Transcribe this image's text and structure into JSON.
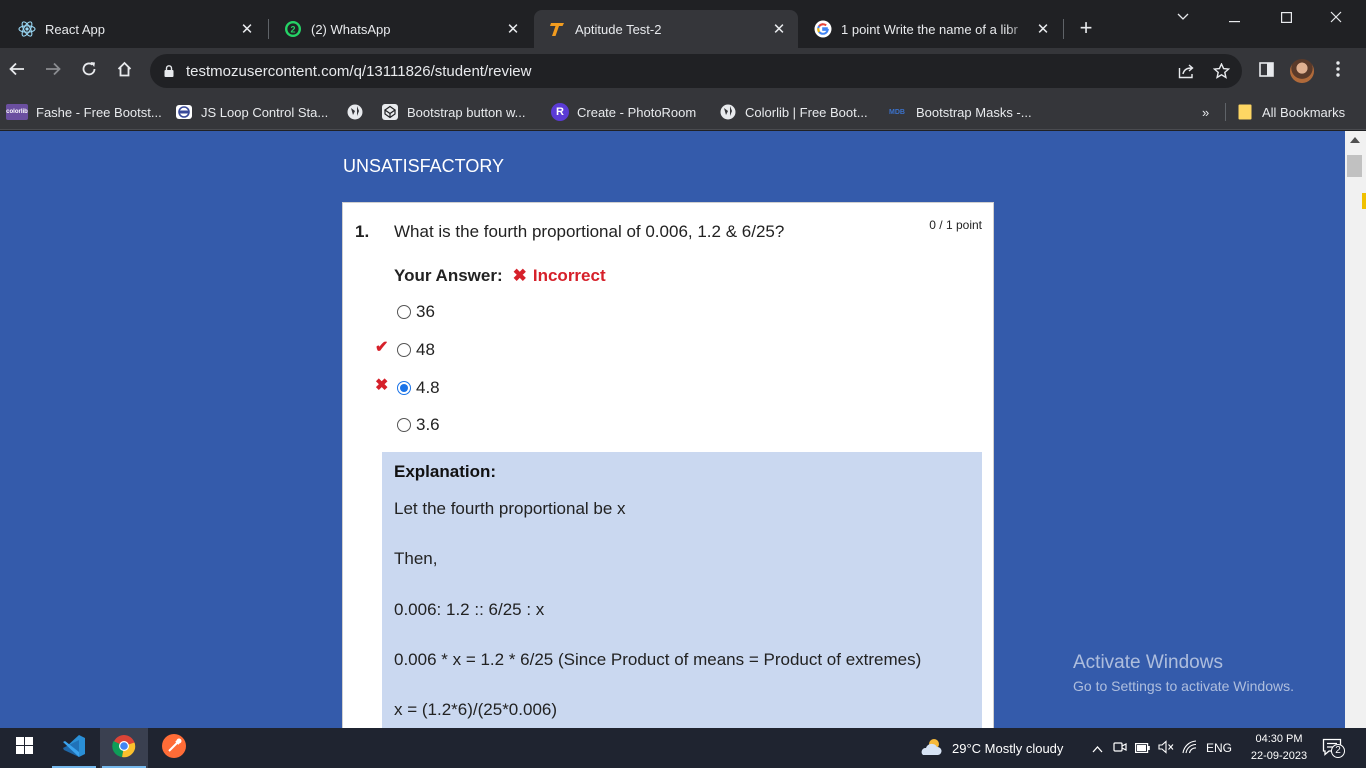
{
  "browser": {
    "tabs": [
      {
        "title": "React App",
        "icon": "react-icon",
        "active": false
      },
      {
        "title": "(2) WhatsApp",
        "icon": "whatsapp-icon",
        "badge": "2",
        "active": false
      },
      {
        "title": "Aptitude Test-2",
        "icon": "testmoz-icon",
        "active": true
      },
      {
        "title": "1 point Write the name of a libr",
        "icon": "google-icon",
        "active": false
      }
    ],
    "url": "testmozusercontent.com/q/13111826/student/review",
    "bookmarks": [
      {
        "label": "Fashe - Free Bootst...",
        "icon": "colorlib-icon",
        "icon_text": "colorlib"
      },
      {
        "label": "JS Loop Control Sta...",
        "icon": "site-logo-icon"
      },
      {
        "label": "",
        "icon": "globe-icon"
      },
      {
        "label": "Bootstrap button w...",
        "icon": "codepen-icon"
      },
      {
        "label": "Create - PhotoRoom",
        "icon": "photoroom-icon",
        "icon_text": "R"
      },
      {
        "label": "Colorlib | Free Boot...",
        "icon": "globe-icon"
      },
      {
        "label": "Bootstrap Masks -...",
        "icon": "mdb-icon",
        "icon_text": "MDB"
      }
    ],
    "bookmarks_overflow": "»",
    "all_bookmarks": "All Bookmarks"
  },
  "page": {
    "result": "UNSATISFACTORY",
    "question": {
      "number": "1.",
      "text": "What is the fourth proportional of 0.006, 1.2 & 6/25?",
      "points": "0 / 1 point",
      "your_answer_label": "Your Answer:",
      "status": "Incorrect",
      "options": [
        {
          "label": "36",
          "selected": false,
          "mark": ""
        },
        {
          "label": "48",
          "selected": false,
          "mark": "correct"
        },
        {
          "label": "4.8",
          "selected": true,
          "mark": "wrong"
        },
        {
          "label": "3.6",
          "selected": false,
          "mark": ""
        }
      ],
      "explanation": {
        "title": "Explanation:",
        "lines": [
          "Let the fourth proportional be x",
          "Then,",
          "0.006: 1.2 :: 6/25 : x",
          "0.006 * x = 1.2 * 6/25 (Since Product of means = Product of extremes)",
          "x = (1.2*6)/(25*0.006)"
        ]
      }
    },
    "watermark": {
      "line1": "Activate Windows",
      "line2": "Go to Settings to activate Windows."
    }
  },
  "taskbar": {
    "apps": [
      "windows-start-icon",
      "vscode-icon",
      "chrome-icon",
      "postman-icon"
    ],
    "weather": "29°C  Mostly cloudy",
    "language": "ENG",
    "time": "04:30 PM",
    "date": "22-09-2023",
    "notifications": "2"
  },
  "colors": {
    "page_bg": "#345bab",
    "explanation_bg": "#cad8f0",
    "error_red": "#d6202a",
    "radio_blue": "#1a73e8"
  }
}
